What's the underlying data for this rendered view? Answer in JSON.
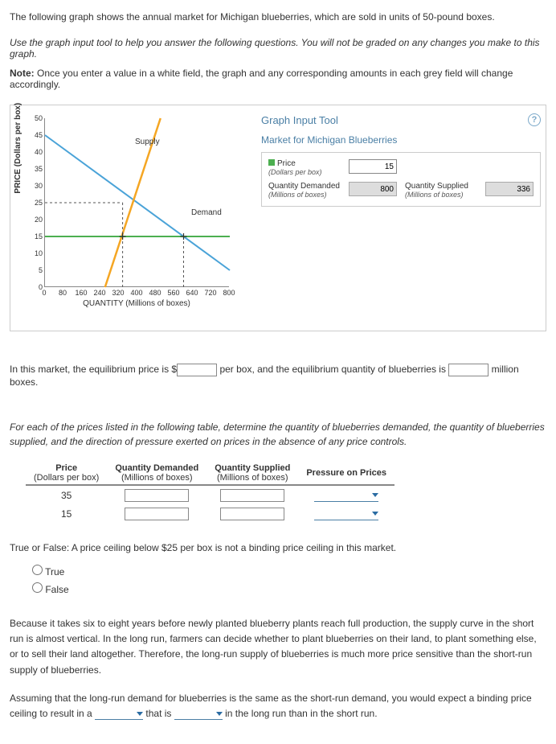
{
  "intro": "The following graph shows the annual market for Michigan blueberries, which are sold in units of 50-pound boxes.",
  "instructions": "Use the graph input tool to help you answer the following questions. You will not be graded on any changes you make to this graph.",
  "note_label": "Note:",
  "note_text": " Once you enter a value in a white field, the graph and any corresponding amounts in each grey field will change accordingly.",
  "tool": {
    "title": "Graph Input Tool",
    "market_title": "Market for Michigan Blueberries",
    "price_label": "Price",
    "price_sub": "(Dollars per box)",
    "price_value": "15",
    "qd_label": "Quantity Demanded",
    "qd_sub": "(Millions of boxes)",
    "qd_value": "800",
    "qs_label": "Quantity Supplied",
    "qs_sub": "(Millions of boxes)",
    "qs_value": "336"
  },
  "chart_data": {
    "type": "line",
    "xlabel": "QUANTITY (Millions of boxes)",
    "ylabel": "PRICE (Dollars per box)",
    "xlim": [
      0,
      800
    ],
    "ylim": [
      0,
      50
    ],
    "xticks": [
      0,
      80,
      160,
      240,
      320,
      400,
      480,
      560,
      640,
      720,
      800
    ],
    "yticks": [
      0,
      5,
      10,
      15,
      20,
      25,
      30,
      35,
      40,
      45,
      50
    ],
    "series": [
      {
        "name": "Supply",
        "color": "#f5a623",
        "points": [
          [
            260,
            0
          ],
          [
            500,
            50
          ]
        ]
      },
      {
        "name": "Demand",
        "color": "#4aa3d8",
        "points": [
          [
            0,
            45
          ],
          [
            800,
            5
          ]
        ]
      }
    ],
    "price_line": {
      "y": 15,
      "color": "#4caf50"
    },
    "guides": [
      {
        "type": "v-dash",
        "x": 336,
        "y_from": 0,
        "y_to": 25
      },
      {
        "type": "h-dash",
        "x_from": 0,
        "x_to": 336,
        "y": 25
      },
      {
        "type": "v-dash",
        "x": 600,
        "y_from": 0,
        "y_to": 15
      }
    ],
    "labels": {
      "supply": "Supply",
      "demand": "Demand"
    }
  },
  "q1": {
    "pre": "In this market, the equilibrium price is ",
    "mid": " per box, and the equilibrium quantity of blueberries is ",
    "post": " million boxes.",
    "currency": "$"
  },
  "q2_intro": "For each of the prices listed in the following table, determine the quantity of blueberries demanded, the quantity of blueberries supplied, and the direction of pressure exerted on prices in the absence of any price controls.",
  "table": {
    "headers": {
      "price": "Price",
      "price_sub": "(Dollars per box)",
      "qd": "Quantity Demanded",
      "qd_sub": "(Millions of boxes)",
      "qs": "Quantity Supplied",
      "qs_sub": "(Millions of boxes)",
      "pressure": "Pressure on Prices"
    },
    "rows": [
      {
        "price": "35"
      },
      {
        "price": "15"
      }
    ]
  },
  "tf": {
    "question": "True or False: A price ceiling below $25 per box is not a binding price ceiling in this market.",
    "opt_true": "True",
    "opt_false": "False"
  },
  "para1": "Because it takes six to eight years before newly planted blueberry plants reach full production, the supply curve in the short run is almost vertical. In the long run, farmers can decide whether to plant blueberries on their land, to plant something else, or to sell their land altogether. Therefore, the long-run supply of blueberries is much more price sensitive than the short-run supply of blueberries.",
  "para2_pre": "Assuming that the long-run demand for blueberries is the same as the short-run demand, you would expect a binding price ceiling to result in a ",
  "para2_mid": " that is ",
  "para2_post": " in the long run than in the short run."
}
